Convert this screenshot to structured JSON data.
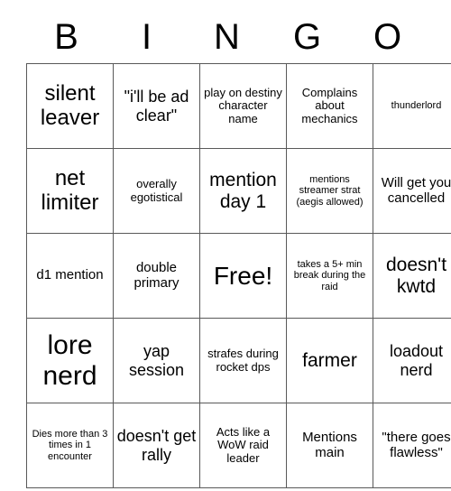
{
  "card": {
    "header_letters": [
      "B",
      "I",
      "N",
      "G",
      "O"
    ],
    "rows": [
      [
        {
          "text": "silent leaver",
          "size": "xxl"
        },
        {
          "text": "\"i'll be ad clear\"",
          "size": "lg"
        },
        {
          "text": "play on destiny character name",
          "size": "sm"
        },
        {
          "text": "Complains about mechanics",
          "size": "sm"
        },
        {
          "text": "thunderlord",
          "size": "xs"
        }
      ],
      [
        {
          "text": "net limiter",
          "size": "xxl"
        },
        {
          "text": "overally egotistical",
          "size": "sm"
        },
        {
          "text": "mention day 1",
          "size": "xl"
        },
        {
          "text": "mentions streamer strat (aegis allowed)",
          "size": "xs"
        },
        {
          "text": "Will get you cancelled",
          "size": "md"
        }
      ],
      [
        {
          "text": "d1 mention",
          "size": "md"
        },
        {
          "text": "double primary",
          "size": "md"
        },
        {
          "text": "Free!",
          "size": "huge"
        },
        {
          "text": "takes a 5+ min break during the raid",
          "size": "xs"
        },
        {
          "text": "doesn't kwtd",
          "size": "xl"
        }
      ],
      [
        {
          "text": "lore nerd",
          "size": "max"
        },
        {
          "text": "yap session",
          "size": "lg"
        },
        {
          "text": "strafes during rocket dps",
          "size": "sm"
        },
        {
          "text": "farmer",
          "size": "xl"
        },
        {
          "text": "loadout nerd",
          "size": "lg"
        }
      ],
      [
        {
          "text": "Dies more than 3 times in 1 encounter",
          "size": "xs"
        },
        {
          "text": "doesn't get rally",
          "size": "lg"
        },
        {
          "text": "Acts like a WoW raid leader",
          "size": "sm"
        },
        {
          "text": "Mentions main",
          "size": "md"
        },
        {
          "text": "\"there goes flawless\"",
          "size": "md"
        }
      ]
    ]
  },
  "colors": {
    "background": "#ffffff",
    "text": "#000000",
    "grid_line": "#595959"
  }
}
